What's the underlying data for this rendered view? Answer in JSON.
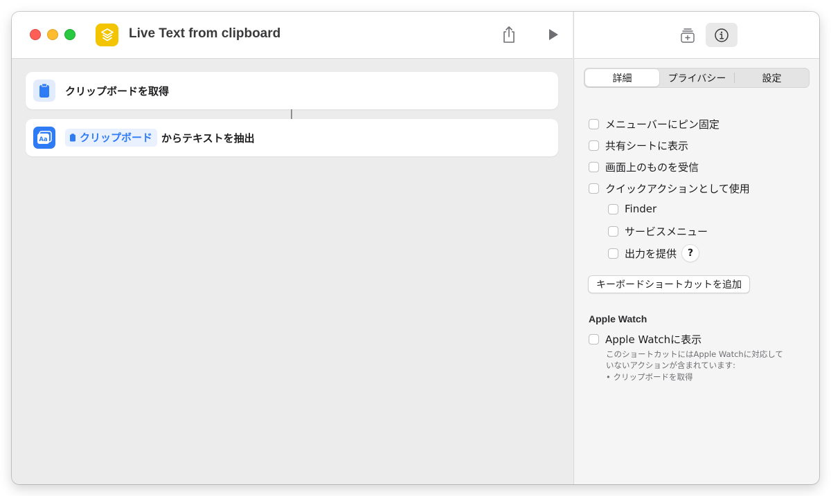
{
  "window": {
    "title": "Live Text from clipboard"
  },
  "colors": {
    "accent": "#2f7bf5",
    "app_icon": "#f2c500",
    "close": "#ff5f57",
    "minimize": "#febc2e",
    "maximize": "#28c840"
  },
  "toolbar": {
    "icons": [
      "share-icon",
      "play-icon"
    ]
  },
  "actions": [
    {
      "icon": "clipboard-icon",
      "label": "クリップボードを取得"
    },
    {
      "icon": "live-text-icon",
      "token": "クリップボード",
      "label": "からテキストを抽出"
    }
  ],
  "sidebar_toolbar": {
    "icons": [
      "action-library-icon",
      "info-icon"
    ]
  },
  "sidebar": {
    "tabs": [
      "詳細",
      "プライバシー",
      "設定"
    ],
    "active_tab": "詳細",
    "options": {
      "pin_menubar": "メニューバーにピン固定",
      "share_sheet": "共有シートに表示",
      "receive_onscreen": "画面上のものを受信",
      "quick_action": "クイックアクションとして使用",
      "finder": "Finder",
      "services_menu": "サービスメニュー",
      "provide_output": "出力を提供"
    },
    "help_label": "?",
    "add_shortcut_button": "キーボードショートカットを追加",
    "apple_watch": {
      "heading": "Apple Watch",
      "show_label": "Apple Watchに表示",
      "note_line1": "このショートカットにはApple Watchに対応して",
      "note_line2": "いないアクションが含まれています:",
      "note_line3": "• クリップボードを取得"
    }
  }
}
